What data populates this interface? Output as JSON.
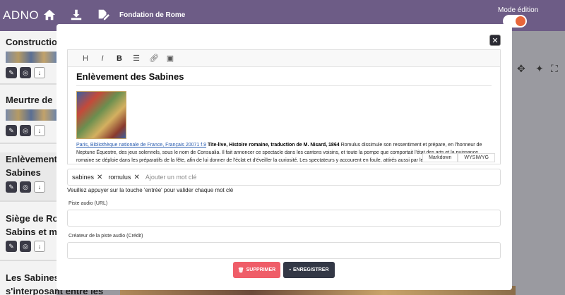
{
  "app": {
    "brand": "ADNO",
    "project_title": "Fondation de Rome",
    "mode_label": "Mode édition"
  },
  "sidebar": {
    "cards": [
      {
        "title_lines": [
          "Construction"
        ]
      },
      {
        "title_lines": [
          "Meurtre de"
        ]
      },
      {
        "title_lines": [
          "Enlèvement",
          "Sabines"
        ]
      },
      {
        "title_lines": [
          "Siège de Ro",
          "Sabins et m"
        ]
      },
      {
        "title_lines": [
          "Les Sabines",
          "s'interposant entre les"
        ]
      }
    ]
  },
  "modal": {
    "editor": {
      "toolbar": [
        "H",
        "I",
        "B",
        "list",
        "link",
        "image"
      ],
      "heading": "Enlèvement des Sabines",
      "link_text": "Paris, Bibliothèque nationale de France, Français 20071 f.9",
      "bold_text": "Tite-live, Histoire romaine, traduction de M. Nisard, 1864",
      "body_text": "Romulus dissimule son ressentiment et prépare, en l'honneur de Neptune Équestre, des jeux solennels, sous le nom de Consualia. Il fait annoncer ce spectacle dans les cantons voisins, et toute la pompe que comportait l'état des arts et la puissance romaine se déploie dans les préparatifs de la fête, afin de lui donner de l'éclat et d'éveiller la curiosité. Les spectateurs y accourent en foule, attirés aussi par le désir de voir la nouvelle ville.",
      "tab_markdown": "Markdown",
      "tab_wysiwyg": "WYSIWYG"
    },
    "tags": [
      "sabines",
      "romulus"
    ],
    "tag_placeholder": "Ajouter un mot clé",
    "tag_hint": "Veuillez appuyer sur la touche 'entrée' pour valider chaque mot clé",
    "audio_url_label": "Piste audio (URL)",
    "audio_url_value": "",
    "audio_credit_label": "Créateur de la piste audio (Crédit)",
    "audio_credit_value": "",
    "delete_label": "SUPPRIMER",
    "save_label": "ENREGISTRER"
  },
  "colors": {
    "topbar": "#6d5c86",
    "toggle_knob": "#e8663a",
    "delete": "#ef5d68",
    "save": "#333846"
  }
}
